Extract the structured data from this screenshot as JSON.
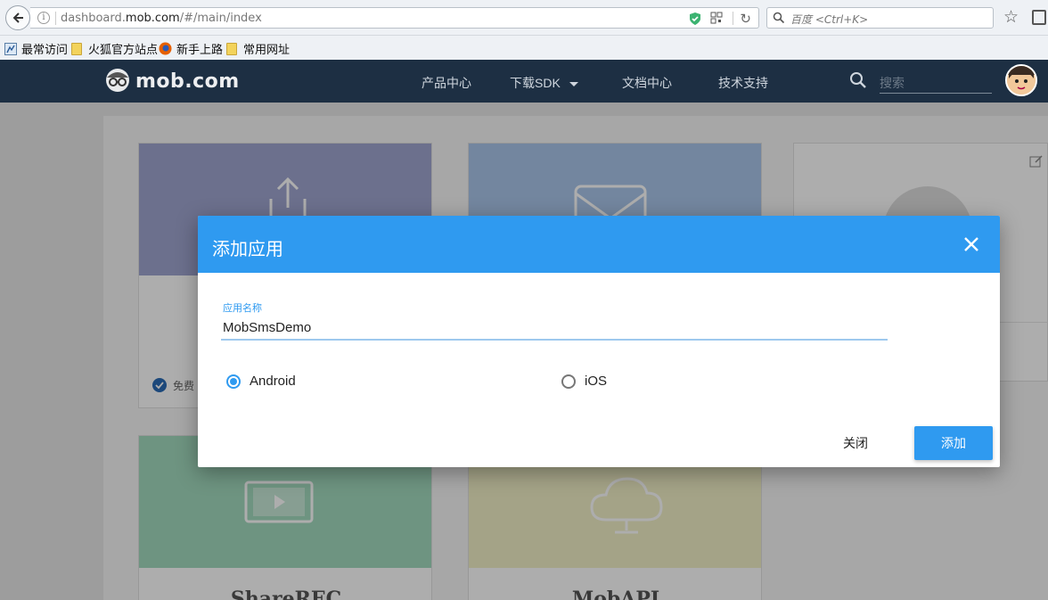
{
  "browser": {
    "url_prefix": "dashboard.",
    "url_domain": "mob.com",
    "url_path": "/#/main/index",
    "search_placeholder": "百度 <Ctrl+K>"
  },
  "bookmarks": [
    {
      "label": "最常访问"
    },
    {
      "label": "火狐官方站点"
    },
    {
      "label": "新手上路"
    },
    {
      "label": "常用网址"
    }
  ],
  "site": {
    "logo_text": "mob.com",
    "nav": [
      {
        "label": "产品中心"
      },
      {
        "label": "下载SDK"
      },
      {
        "label": "文档中心"
      },
      {
        "label": "技术支持"
      }
    ],
    "search_placeholder": "搜索"
  },
  "cards": {
    "footer_text": "免费",
    "titles": [
      "ShareREC",
      "MobAPI"
    ]
  },
  "modal": {
    "title": "添加应用",
    "field_label": "应用名称",
    "field_value": "MobSmsDemo",
    "platforms": [
      {
        "label": "Android",
        "checked": true
      },
      {
        "label": "iOS",
        "checked": false
      }
    ],
    "close_label": "关闭",
    "add_label": "添加"
  },
  "colors": {
    "accent": "#2f9af0",
    "header_bg": "#1d2f43"
  }
}
